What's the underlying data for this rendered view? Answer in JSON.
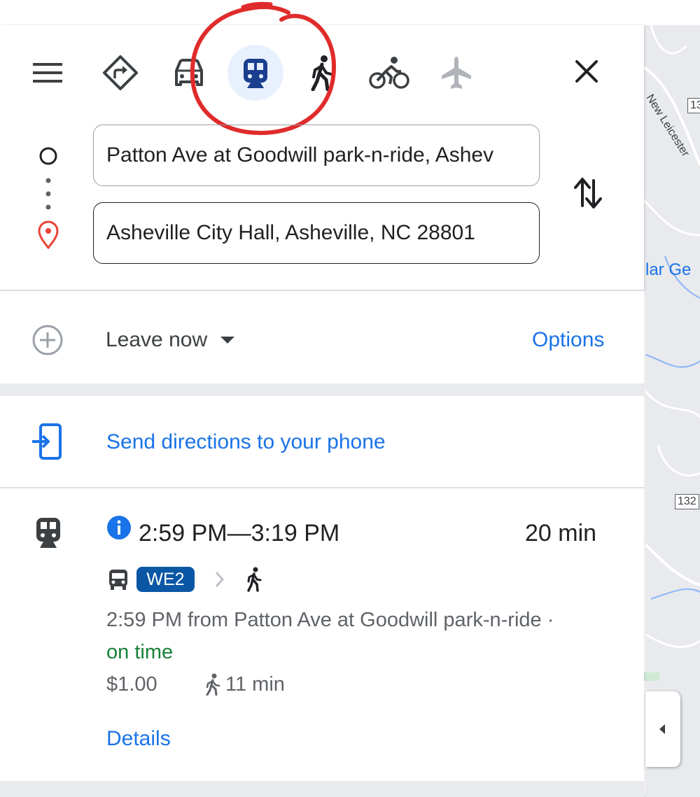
{
  "modes": [
    {
      "name": "best-route",
      "icon": "directions-diamond-icon"
    },
    {
      "name": "driving",
      "icon": "car-icon"
    },
    {
      "name": "transit",
      "icon": "train-icon",
      "selected": true
    },
    {
      "name": "walking",
      "icon": "walking-icon"
    },
    {
      "name": "cycling",
      "icon": "bicycle-icon"
    },
    {
      "name": "flights",
      "icon": "airplane-icon"
    }
  ],
  "search": {
    "origin_value": "Patton Ave at Goodwill park-n-ride, Ashev",
    "destination_value": "Asheville City Hall, Asheville, NC 28801"
  },
  "timing": {
    "leave_label": "Leave now",
    "options_label": "Options"
  },
  "send_to_phone": {
    "label": "Send directions to your phone"
  },
  "route": {
    "time_range": "2:59 PM—3:19 PM",
    "duration": "20 min",
    "bus_line": "WE2",
    "departure_text": "2:59 PM from Patton Ave at Goodwill park-n-ride ·",
    "status": "on time",
    "fare": "$1.00",
    "walk_time": "11 min",
    "details_label": "Details"
  },
  "map": {
    "road_label": "New Leicester",
    "route_shield_1": "13",
    "route_shield_2": "132",
    "place_fragment": "lar Ge"
  },
  "colors": {
    "accent": "#1a73e8",
    "status_green": "#188038",
    "badge_blue": "#0b57a6",
    "annotation_red": "#e02b2b",
    "selected_bg": "#e8f0fe"
  }
}
